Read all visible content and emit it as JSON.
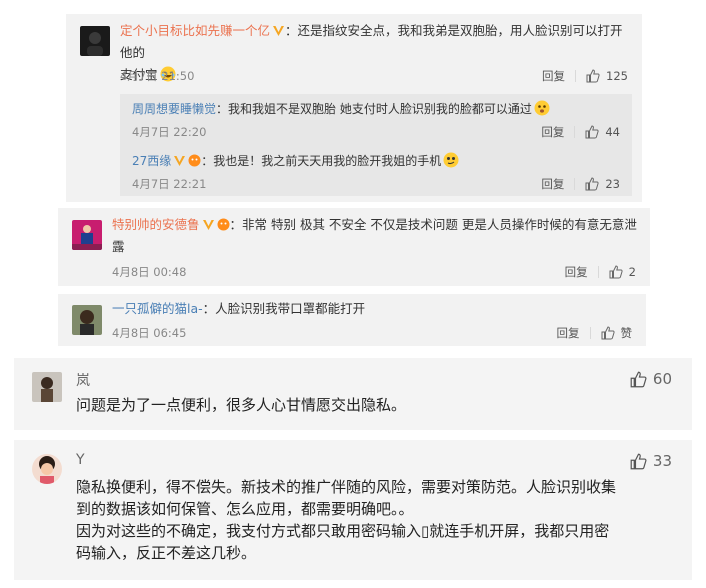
{
  "comments": [
    {
      "name": "定个小目标比如先赚一个亿",
      "text_line1": "：还是指纹安全点，我和我弟是双胞胎，用人脸识别可以打开他的",
      "text_line2": "支付宝",
      "time": "4月7日 21:50",
      "reply_label": "回复",
      "likes": "125",
      "replies": [
        {
          "name": "周周想要睡懒觉",
          "text": "：我和我姐不是双胞胎 她支付时人脸识别我的脸都可以通过",
          "time": "4月7日 22:20",
          "reply_label": "回复",
          "likes": "44"
        },
        {
          "name": "27西缘",
          "text": "：我也是！我之前天天用我的脸开我姐的手机",
          "time": "4月7日 22:21",
          "reply_label": "回复",
          "likes": "23"
        }
      ]
    },
    {
      "name": "特别帅的安德鲁",
      "text_line1": "：非常 特别 极其 不安全 不仅是技术问题 更是人员操作时候的有意无意泄",
      "text_line2": "露",
      "time": "4月8日 00:48",
      "reply_label": "回复",
      "likes": "2"
    },
    {
      "name": "一只孤僻的猫la-",
      "text": "：人脸识别我带口罩都能打开",
      "time": "4月8日 06:45",
      "reply_label": "回复",
      "likes": "赞"
    }
  ],
  "big_comments": [
    {
      "name": "岚",
      "likes": "60",
      "lines": [
        "问题是为了一点便利，很多人心甘情愿交出隐私。"
      ]
    },
    {
      "name": "Y",
      "likes": "33",
      "lines": [
        "隐私换便利，得不偿失。新技术的推广伴随的风险，需要对策防范。人脸识别收集",
        "到的数据该如何保管、怎么应用，都需要明确吧。。",
        "因为对这些的不确定，我支付方式都只敢用密码输入▯就连手机开屏，我都只用密",
        "码输入，反正不差这几秒。"
      ]
    }
  ],
  "colors": {
    "name_orange": "#eb7350",
    "reply_blue": "#4a7fb5",
    "badge_orange": "#f5a623",
    "card_bg": "#f2f2f2",
    "reply_bg": "#e7e7e7"
  }
}
